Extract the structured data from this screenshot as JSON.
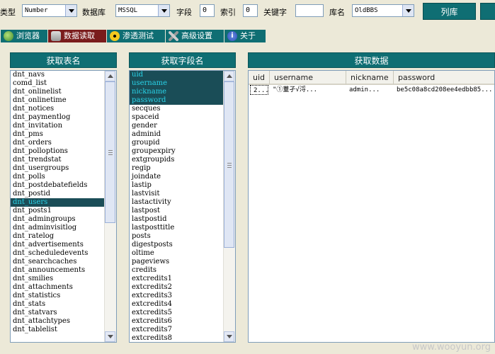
{
  "toolbar": {
    "type_label": "类型",
    "type_value": "Number",
    "db_label": "数据库",
    "db_value": "MSSQL",
    "field_label": "字段",
    "field_value": "0",
    "index_label": "索引",
    "index_value": "0",
    "keyword_label": "关键字",
    "keyword_value": "",
    "dbname_label": "库名",
    "dbname_value": "OldBBS",
    "list_db_button": "列库"
  },
  "tabs": [
    {
      "label": "浏览器",
      "icon": "globe-icon",
      "active": false
    },
    {
      "label": "数据读取",
      "icon": "database-icon",
      "active": true
    },
    {
      "label": "渗透测试",
      "icon": "radiation-icon",
      "active": false
    },
    {
      "label": "高级设置",
      "icon": "tools-icon",
      "active": false
    },
    {
      "label": "关于",
      "icon": "info-icon",
      "active": false
    }
  ],
  "tables_panel": {
    "title": "获取表名",
    "items": [
      "dnt_navs",
      "comd_list",
      "dnt_onlinelist",
      "dnt_onlinetime",
      "dnt_notices",
      "dnt_paymentlog",
      "dnt_invitation",
      "dnt_pms",
      "dnt_orders",
      "dnt_polloptions",
      "dnt_trendstat",
      "dnt_usergroups",
      "dnt_polls",
      "dnt_postdebatefields",
      "dnt_postid",
      "dnt_users",
      "dnt_posts1",
      "dnt_admingroups",
      "dnt_adminvisitlog",
      "dnt_ratelog",
      "dnt_advertisements",
      "dnt_scheduledevents",
      "dnt_searchcaches",
      "dnt_announcements",
      "dnt_smilies",
      "dnt_attachments",
      "dnt_statistics",
      "dnt_stats",
      "dnt_statvars",
      "dnt_attachtypes",
      "dnt_tablelist"
    ],
    "selected": [
      "dnt_users"
    ]
  },
  "fields_panel": {
    "title": "获取字段名",
    "items": [
      "uid",
      "username",
      "nickname",
      "password",
      "secques",
      "spaceid",
      "gender",
      "adminid",
      "groupid",
      "groupexpiry",
      "extgroupids",
      "regip",
      "joindate",
      "lastip",
      "lastvisit",
      "lastactivity",
      "lastpost",
      "lastpostid",
      "lastposttitle",
      "posts",
      "digestposts",
      "oltime",
      "pageviews",
      "credits",
      "extcredits1",
      "extcredits2",
      "extcredits3",
      "extcredits4",
      "extcredits5",
      "extcredits6",
      "extcredits7",
      "extcredits8"
    ],
    "selected": [
      "uid",
      "username",
      "nickname",
      "password"
    ]
  },
  "data_panel": {
    "title": "获取数据",
    "columns": [
      "uid",
      "username",
      "nickname",
      "password"
    ],
    "rows": [
      [
        "2...",
        "\"①蕫孑√浖...",
        "admin...",
        "be5c08a8cd208ee4edbb85..."
      ]
    ]
  },
  "watermark": "www.wooyun.org"
}
